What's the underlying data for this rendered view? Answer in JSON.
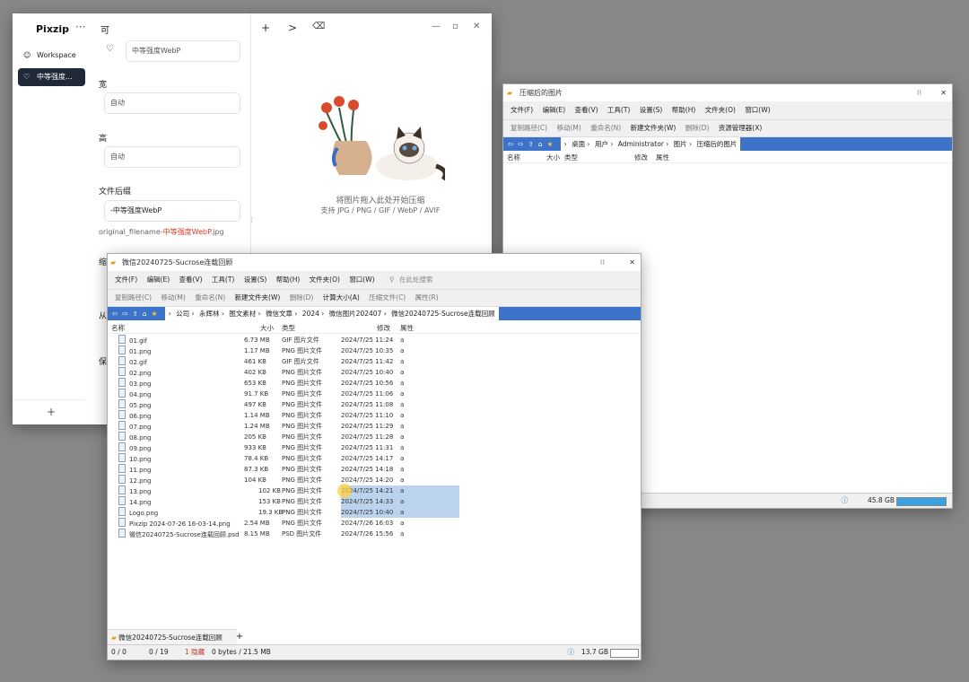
{
  "pixzip": {
    "brand": "Pixzip",
    "menu_dots": "···",
    "nav": [
      {
        "label": "Workspace",
        "icon": "☺"
      },
      {
        "label": "中等强度...",
        "icon": "♡"
      }
    ],
    "add": "+",
    "header_top": "可",
    "preset_heart": "♡",
    "preset_name": "中等强度WebP",
    "field1_label": "宽",
    "field1_placeholder": "自动",
    "field2_label": "高",
    "field2_placeholder": "自动",
    "filename_label": "文件后缀",
    "filename_value": "-中等强度WebP",
    "filename_preview_plain": "original_filename",
    "filename_preview_red": "-中等强度WebP",
    "filename_preview_ext": ".jpg",
    "toolbar": [
      "+",
      ">",
      "⌫"
    ],
    "window_controls": [
      "—",
      "▫",
      "✕"
    ],
    "drop_text": "将图片拖入此处开始压缩",
    "drop_formats": "支持 JPG / PNG / GIF / WebP / AVIF",
    "peek_labels": [
      "缩",
      "从",
      "保"
    ]
  },
  "explorer_back": {
    "title": "压缩后的图片",
    "menu": [
      "文件(F)",
      "编辑(E)",
      "查看(V)",
      "工具(T)",
      "设置(S)",
      "帮助(H)",
      "文件夹(O)",
      "窗口(W)"
    ],
    "actions": [
      "复制路径(C)",
      "移动(M)",
      "重命名(N)",
      "新建文件夹(W)",
      "删除(D)",
      "资源管理器(X)"
    ],
    "address": [
      "桌面",
      "用户",
      "Administrator",
      "图片",
      "压缩后的图片"
    ],
    "columns": [
      "名称",
      "大小",
      "类型",
      "修改",
      "属性"
    ],
    "status": "45.8 GB"
  },
  "explorer_front": {
    "title": "微信20240725-Sucrose连载回顾",
    "menu": [
      "文件(F)",
      "编辑(E)",
      "查看(V)",
      "工具(T)",
      "设置(S)",
      "帮助(H)",
      "文件夹(O)",
      "窗口(W)"
    ],
    "actions": [
      "复制路径(C)",
      "移动(M)",
      "重命名(N)",
      "新建文件夹(W)",
      "删除(D)",
      "计算大小(A)",
      "压缩文件(C)",
      "属性(R)"
    ],
    "search_placeholder": "在此处搜索",
    "address": [
      "公司",
      "永辉林",
      "图文素材",
      "微信文章",
      "2024",
      "微信图片202407",
      "微信20240725-Sucrose连载回顾"
    ],
    "columns": [
      "名称",
      "大小",
      "类型",
      "修改",
      "属性"
    ],
    "files": [
      {
        "name": "01.gif",
        "size": "6.73 MB",
        "type": "GIF 图片文件",
        "date": "2024/7/25 11:24",
        "attr": "a"
      },
      {
        "name": "01.png",
        "size": "1.17 MB",
        "type": "PNG 图片文件",
        "date": "2024/7/25 10:35",
        "attr": "a"
      },
      {
        "name": "02.gif",
        "size": "461 KB",
        "type": "GIF 图片文件",
        "date": "2024/7/25 11:42",
        "attr": "a"
      },
      {
        "name": "02.png",
        "size": "402 KB",
        "type": "PNG 图片文件",
        "date": "2024/7/25 10:40",
        "attr": "a"
      },
      {
        "name": "03.png",
        "size": "653 KB",
        "type": "PNG 图片文件",
        "date": "2024/7/25 10:56",
        "attr": "a"
      },
      {
        "name": "04.png",
        "size": "91.7 KB",
        "type": "PNG 图片文件",
        "date": "2024/7/25 11:06",
        "attr": "a"
      },
      {
        "name": "05.png",
        "size": "497 KB",
        "type": "PNG 图片文件",
        "date": "2024/7/25 11:08",
        "attr": "a"
      },
      {
        "name": "06.png",
        "size": "1.14 MB",
        "type": "PNG 图片文件",
        "date": "2024/7/25 11:10",
        "attr": "a"
      },
      {
        "name": "07.png",
        "size": "1.24 MB",
        "type": "PNG 图片文件",
        "date": "2024/7/25 11:29",
        "attr": "a"
      },
      {
        "name": "08.png",
        "size": "205 KB",
        "type": "PNG 图片文件",
        "date": "2024/7/25 11:28",
        "attr": "a"
      },
      {
        "name": "09.png",
        "size": "933 KB",
        "type": "PNG 图片文件",
        "date": "2024/7/25 11:31",
        "attr": "a"
      },
      {
        "name": "10.png",
        "size": "78.4 KB",
        "type": "PNG 图片文件",
        "date": "2024/7/25 14:17",
        "attr": "a"
      },
      {
        "name": "11.png",
        "size": "87.3 KB",
        "type": "PNG 图片文件",
        "date": "2024/7/25 14:18",
        "attr": "a"
      },
      {
        "name": "12.png",
        "size": "104 KB",
        "type": "PNG 图片文件",
        "date": "2024/7/25 14:20",
        "attr": "a"
      },
      {
        "name": "13.png",
        "size": "102 KB",
        "type": "PNG 图片文件",
        "date": "2024/7/25 14:21",
        "attr": "a"
      },
      {
        "name": "14.png",
        "size": "153 KB",
        "type": "PNG 图片文件",
        "date": "2024/7/25 14:33",
        "attr": "a"
      },
      {
        "name": "Logo.png",
        "size": "19.3 KB",
        "type": "PNG 图片文件",
        "date": "2024/7/25 10:40",
        "attr": "a"
      },
      {
        "name": "Pixzip 2024-07-26 16-03-14.png",
        "size": "2.54 MB",
        "type": "PNG 图片文件",
        "date": "2024/7/26 16:03",
        "attr": "a"
      },
      {
        "name": "微信20240725-Sucrose连载回顾.psd",
        "size": "8.15 MB",
        "type": "PSD 图片文件",
        "date": "2024/7/26 15:56",
        "attr": "a"
      }
    ],
    "tab_label": "微信20240725-Sucrose连载回顾",
    "status": {
      "a": "0 / 0",
      "b": "0 / 19",
      "hidden": "1 隐藏",
      "bytes": "0 bytes / 21.5 MB",
      "disk": "13.7 GB"
    }
  }
}
